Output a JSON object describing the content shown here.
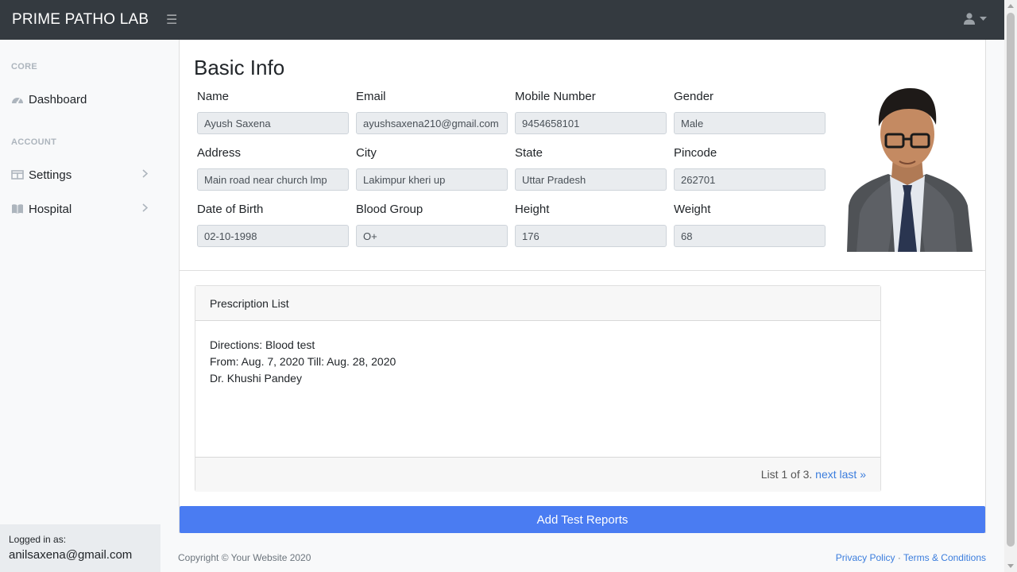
{
  "brand": "PRIME PATHO LAB",
  "sidebar": {
    "core_heading": "CORE",
    "account_heading": "ACCOUNT",
    "items": [
      {
        "label": "Dashboard",
        "icon": "tachometer-icon"
      },
      {
        "label": "Settings",
        "icon": "columns-icon"
      },
      {
        "label": "Hospital",
        "icon": "book-open-icon"
      }
    ],
    "footer": {
      "label": "Logged in as:",
      "user": "anilsaxena@gmail.com"
    }
  },
  "basic_info": {
    "title": "Basic Info",
    "fields": [
      {
        "label": "Name",
        "value": "Ayush Saxena"
      },
      {
        "label": "Email",
        "value": "ayushsaxena210@gmail.com"
      },
      {
        "label": "Mobile Number",
        "value": "9454658101"
      },
      {
        "label": "Gender",
        "value": "Male"
      },
      {
        "label": "Address",
        "value": "Main road near church lmp"
      },
      {
        "label": "City",
        "value": "Lakimpur kheri up"
      },
      {
        "label": "State",
        "value": "Uttar Pradesh"
      },
      {
        "label": "Pincode",
        "value": "262701"
      },
      {
        "label": "Date of Birth",
        "value": "02-10-1998"
      },
      {
        "label": "Blood Group",
        "value": "O+"
      },
      {
        "label": "Height",
        "value": "176"
      },
      {
        "label": "Weight",
        "value": "68"
      }
    ]
  },
  "prescription": {
    "header": "Prescription List",
    "directions": "Directions: Blood test",
    "dates": "From: Aug. 7, 2020 Till: Aug. 28, 2020",
    "doctor": "Dr. Khushi Pandey",
    "pagination_text": "List 1 of 3.",
    "next_label": "next",
    "last_label": "last »"
  },
  "add_button": "Add Test Reports",
  "footer": {
    "copyright": "Copyright © Your Website 2020",
    "privacy": "Privacy Policy",
    "separator": "·",
    "terms": "Terms & Conditions"
  },
  "colors": {
    "navbar": "#343a40",
    "primary_button": "#4a7cf2",
    "link": "#3b7ddd"
  }
}
